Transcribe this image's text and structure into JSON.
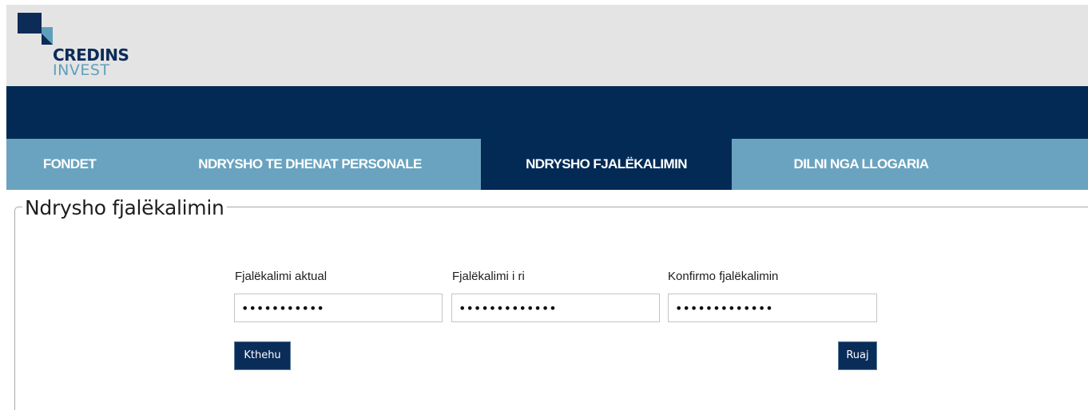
{
  "header": {
    "logo": {
      "line1": "CREDINS",
      "line2": "INVEST",
      "mark_icon": "credins-logo-mark",
      "colors": {
        "dark": "#0c2b57",
        "light": "#5f9fbc"
      }
    }
  },
  "nav": {
    "items": [
      {
        "label": "FONDET",
        "active": false
      },
      {
        "label": "NDRYSHO TE DHENAT PERSONALE",
        "active": false
      },
      {
        "label": "NDRYSHO FJALËKALIMIN",
        "active": true
      },
      {
        "label": "DILNI NGA LLOGARIA",
        "active": false
      }
    ],
    "colors": {
      "bar": "#6aa3bf",
      "active": "#022a55"
    }
  },
  "form": {
    "title": "Ndrysho fjalëkalimin",
    "fields": [
      {
        "label": "Fjalëkalimi aktual",
        "type": "password",
        "value": "xxxxxxxxxxx"
      },
      {
        "label": "Fjalëkalimi i ri",
        "type": "password",
        "value": "xxxxxxxxxxxxx"
      },
      {
        "label": "Konfirmo fjalëkalimin",
        "type": "password",
        "value": "xxxxxxxxxxxxx"
      }
    ],
    "back_button": "Kthehu",
    "save_button": "Ruaj"
  }
}
